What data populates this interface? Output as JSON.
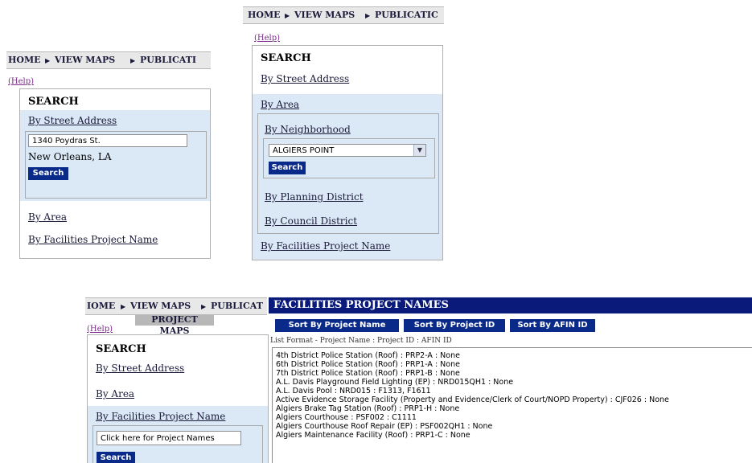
{
  "nav": {
    "home": "HOME",
    "view_maps": "VIEW MAPS",
    "pub_left": "PUBLICATI",
    "pub_mid": "PUBLICATIC",
    "pub_bot": "PUBLICAT",
    "home_bot": "IOME",
    "project_maps": "PROJECT MAPS"
  },
  "help": "(Help)",
  "search": {
    "title": "SEARCH",
    "by_street": "By Street Address",
    "by_area": "By Area",
    "by_facilities": "By Facilities Project Name",
    "address_value": "1340 Poydras St.",
    "city": "New Orleans, LA",
    "search_btn": "Search",
    "by_neighborhood": "By Neighborhood",
    "neighborhood_value": "ALGIERS POINT",
    "by_planning": "By Planning District",
    "by_council": "By Council District",
    "project_input": "Click here for Project Names"
  },
  "results": {
    "title": "FACILITIES PROJECT NAMES",
    "sort_name": "Sort By Project Name",
    "sort_id": "Sort By Project ID",
    "sort_afin": "Sort By AFIN ID",
    "format": "List Format - Project Name : Project ID : AFIN ID",
    "items": [
      "4th District Police Station (Roof) : PRP2-A : None",
      "6th District Police Station (Roof) : PRP1-A : None",
      "7th District Police Station (Roof) : PRP1-B : None",
      "A.L. Davis Playground Field Lighting (EP) : NRD015QH1 : None",
      "A.L. Davis Pool : NRD015 : F1313, F1611",
      "Active Evidence Storage Facility (Property and Evidence/Clerk of Court/NOPD Property) : CJF026 : None",
      "Algiers Brake Tag Station (Roof) : PRP1-H : None",
      "Algiers Courthouse : PSF002 : C1111",
      "Algiers Courthouse Roof Repair (EP) : PSF002QH1 : None",
      "Algiers Maintenance Facility (Roof) : PRP1-C : None"
    ]
  },
  "colors": {
    "accent": "#0a2a8a",
    "highlight": "#dbe8f6",
    "help": "#7a2a8a"
  }
}
